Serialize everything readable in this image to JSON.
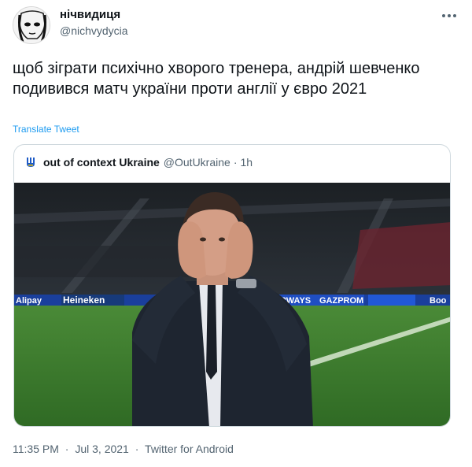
{
  "author": {
    "name": "нічвидиця",
    "handle": "@nichvydycia",
    "avatar_icon": "sketch-face-avatar"
  },
  "tweet": {
    "text": "щоб зіграти психічно хворого тренера, андрій шевченко подивився матч україни проти англії у євро 2021",
    "translate_label": "Translate Tweet"
  },
  "quote": {
    "name": "out of context Ukraine",
    "handle": "@OutUkraine",
    "separator": "·",
    "time": "1h",
    "avatar_icon": "ukraine-trident-avatar",
    "media": {
      "board_texts": [
        "Alipay",
        "Heineken",
        "RWAYS",
        "GAZPROM",
        "Boo"
      ]
    }
  },
  "meta": {
    "time": "11:35 PM",
    "separator1": "·",
    "date": "Jul 3, 2021",
    "separator2": "·",
    "source": "Twitter for Android"
  },
  "colors": {
    "link": "#1d9bf0",
    "text": "#0f1419",
    "secondary": "#536471",
    "border": "#cfd9de",
    "pitch": "#3f7d2f",
    "board_blue": "#1a3f9c"
  }
}
